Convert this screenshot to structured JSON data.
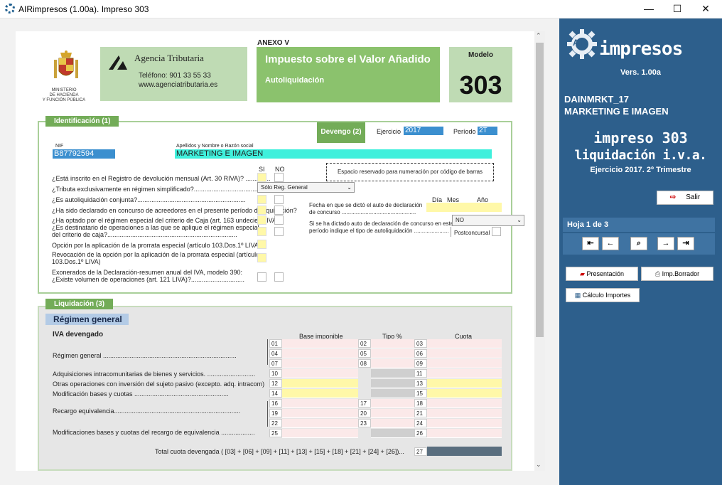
{
  "window": {
    "title": "AIRimpresos (1.00a). Impreso 303",
    "minimize": "—",
    "maximize": "☐",
    "close": "✕"
  },
  "header": {
    "ministry": [
      "MINISTERIO",
      "DE HACIENDA",
      "Y FUNCIÓN PÚBLICA"
    ],
    "agency": "Agencia Tributaria",
    "phone": "Teléfono: 901 33 55 33",
    "web": "www.agenciatributaria.es",
    "anexo": "ANEXO V",
    "tax_title": "Impuesto sobre el Valor Añadido",
    "tax_sub": "Autoliquidación",
    "modelo_label": "Modelo",
    "modelo_num": "303"
  },
  "ident": {
    "section": "Identificación (1)",
    "devengo": "Devengo (2)",
    "ejercicio_label": "Ejercicio",
    "ejercicio": "2017",
    "periodo_label": "Período",
    "periodo": "2T",
    "nif_label": "NIF",
    "nif": "B87792594",
    "name_label": "Apellidos y Nombre o Razón social",
    "name": "MARKETING E IMAGEN",
    "si": "SI",
    "no": "NO",
    "barcode": "Espacio reservado para numeración por código de barras",
    "q1": "¿Está inscrito en el Registro de devolución mensual (Art. 30 RIVA)? ..............",
    "q2": "¿Tributa exclusivamente en régimen simplificado?.....................................",
    "q2_select": "Sólo Reg. General",
    "q3": "¿Es autoliquidación conjunta?.............................................................",
    "q4": "¿Ha sido declarado en concurso de acreedores en el presente período de liquidación?",
    "q5": "¿Ha optado por el régimen especial del criterio de Caja (art. 163 undecies LIVA)?",
    "q6a": "¿Es destinatario de operaciones a las que se aplique el régimen especial",
    "q6b": "del criterio de caja?.........................................................................",
    "q7": "Opción por la aplicación de la prorrata especial (artículo 103.Dos.1º LIVA)..",
    "q8a": "Revocación de la opción por la aplicación de la prorrata especial (artículo",
    "q8b": "103.Dos.1º LIVA)",
    "q9a": "Exonerados de la Declaración-resumen anual del IVA, modelo 390:",
    "q9b": "¿Existe volumen de operaciones (art. 121 LIVA)?..............................",
    "dia": "Día",
    "mes": "Mes",
    "ano": "Año",
    "fecha_a": "Fecha en que se dictó el auto de declaración",
    "fecha_b": "de concurso ...............................................",
    "auto_a": "Si se ha dictado auto de declaración de concurso en este",
    "auto_b": "período indique el tipo de autoliquidación ......................",
    "auto_select": "NO",
    "postconcursal": "Postconcursal"
  },
  "liq": {
    "section": "Liquidación (3)",
    "regimen": "Régimen general",
    "iva_devengado": "IVA devengado",
    "col_base": "Base imponible",
    "col_tipo": "Tipo %",
    "col_cuota": "Cuota",
    "rows": [
      {
        "label": "Régimen general ...........................................................................",
        "cells": [
          [
            "01",
            "02",
            "03"
          ],
          [
            "04",
            "05",
            "06"
          ],
          [
            "07",
            "08",
            "09"
          ]
        ]
      },
      {
        "label": "Adquisiciones intracomunitarias de bienes y servicios. ...........................",
        "cells": [
          [
            "10",
            "",
            "11"
          ]
        ]
      },
      {
        "label": "Otras operaciones con inversión del sujeto pasivo (excepto. adq. intracom)",
        "cells": [
          [
            "12",
            "",
            "13"
          ]
        ]
      },
      {
        "label": "Modificación bases y cuotas .....................................................",
        "cells": [
          [
            "14",
            "",
            "15"
          ]
        ]
      },
      {
        "label": "Recargo equivalencia.......................................................................",
        "cells": [
          [
            "16",
            "17",
            "18"
          ],
          [
            "19",
            "20",
            "21"
          ],
          [
            "22",
            "23",
            "24"
          ]
        ]
      },
      {
        "label": "Modificaciones bases y cuotas del recargo de equivalencia ...................",
        "cells": [
          [
            "25",
            "",
            "26"
          ]
        ]
      }
    ],
    "total_label": "Total cuota devengada ( [03] + [06] + [09] + [11] + [13] + [15] + [18] + [21] + [24] + [26])...",
    "total_num": "27"
  },
  "panel": {
    "logo_air": "AIR",
    "logo_text": "impresos",
    "version": "Vers. 1.00a",
    "company_code": "DAINMRKT_17",
    "company_name": "MARKETING E IMAGEN",
    "impreso": "impreso 303",
    "liquidacion": "liquidación i.v.a.",
    "ejercicio": "Ejercicio 2017. 2º Trimestre",
    "salir": "Salir",
    "hoja": "Hoja 1 de 3",
    "presentacion": "Presentación",
    "borrador": "Imp.Borrador",
    "calculo": "Cálculo Importes"
  }
}
